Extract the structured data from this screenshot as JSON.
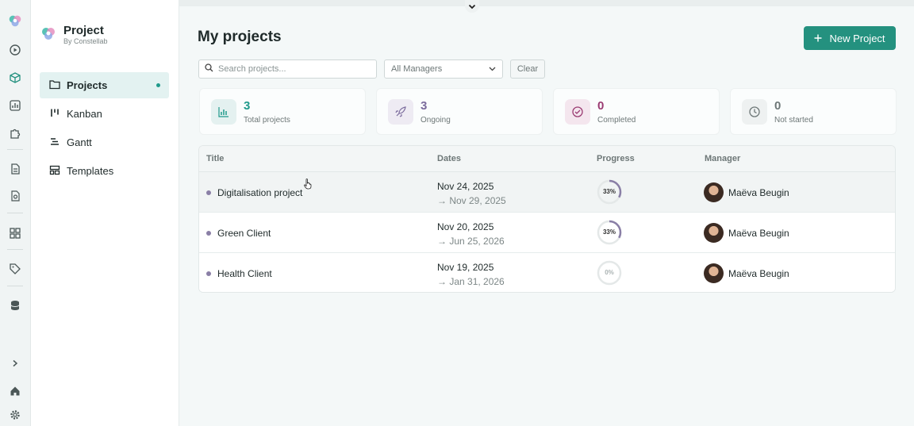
{
  "brand": {
    "name": "Project",
    "subtitle": "By Constellab"
  },
  "sidebar": {
    "items": [
      {
        "label": "Projects",
        "icon": "folder-icon",
        "active": true
      },
      {
        "label": "Kanban",
        "icon": "kanban-icon",
        "active": false
      },
      {
        "label": "Gantt",
        "icon": "gantt-icon",
        "active": false
      },
      {
        "label": "Templates",
        "icon": "templates-icon",
        "active": false
      }
    ]
  },
  "rail": {
    "icons": [
      "constellab-logo-icon",
      "play-circle-icon",
      "cube-icon",
      "chart-icon",
      "puzzle-icon",
      "document-icon",
      "file-report-icon",
      "dashboard-icon",
      "tag-icon",
      "database-icon",
      "chevron-right-icon",
      "home-icon",
      "settings-icon"
    ]
  },
  "main": {
    "title": "My projects",
    "new_button": "New Project",
    "search_placeholder": "Search projects...",
    "manager_filter": "All Managers",
    "clear_button": "Clear"
  },
  "stats": [
    {
      "value": "3",
      "label": "Total projects",
      "icon": "bar-chart-icon",
      "color": "#1f9a8b",
      "bg": "#e4f1f0"
    },
    {
      "value": "3",
      "label": "Ongoing",
      "icon": "rocket-icon",
      "color": "#7a6a9c",
      "bg": "#eeebf3"
    },
    {
      "value": "0",
      "label": "Completed",
      "icon": "check-circle-icon",
      "color": "#9a3b72",
      "bg": "#f4e6ee"
    },
    {
      "value": "0",
      "label": "Not started",
      "icon": "clock-icon",
      "color": "#6d7777",
      "bg": "#eef1f1"
    }
  ],
  "table": {
    "columns": [
      "Title",
      "Dates",
      "Progress",
      "Manager"
    ],
    "rows": [
      {
        "title": "Digitalisation project",
        "start": "Nov 24, 2025",
        "end": "→ Nov 29, 2025",
        "progress": 33,
        "progress_label": "33%",
        "manager": "Maëva Beugin"
      },
      {
        "title": "Green Client",
        "start": "Nov 20, 2025",
        "end": "→ Jun 25, 2026",
        "progress": 33,
        "progress_label": "33%",
        "manager": "Maëva Beugin"
      },
      {
        "title": "Health Client",
        "start": "Nov 19, 2025",
        "end": "→ Jan 31, 2026",
        "progress": 0,
        "progress_label": "0%",
        "manager": "Maëva Beugin"
      }
    ]
  },
  "colors": {
    "accent": "#24917f",
    "progress": "#8a7fa6",
    "track": "#e4e8e8"
  }
}
